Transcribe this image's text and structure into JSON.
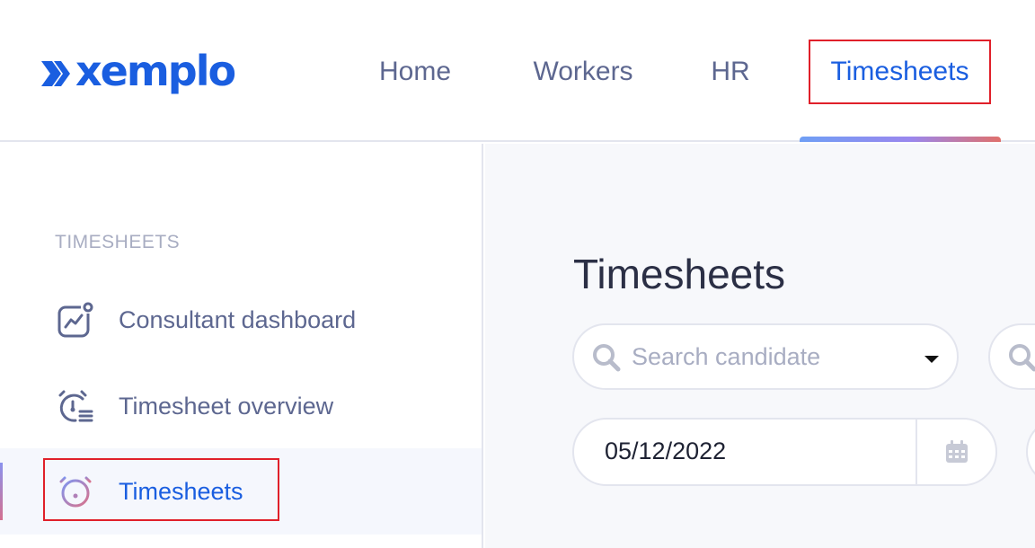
{
  "app": {
    "logo_text": "xemplo"
  },
  "nav": {
    "items": [
      {
        "label": "Home"
      },
      {
        "label": "Workers"
      },
      {
        "label": "HR"
      },
      {
        "label": "Timesheets",
        "active": true
      }
    ]
  },
  "sidebar": {
    "heading": "TIMESHEETS",
    "items": [
      {
        "label": "Consultant dashboard",
        "icon": "chart-dashboard-icon"
      },
      {
        "label": "Timesheet overview",
        "icon": "clock-list-icon"
      },
      {
        "label": "Timesheets",
        "icon": "alarm-clock-icon",
        "active": true
      }
    ]
  },
  "main": {
    "title": "Timesheets",
    "search": {
      "placeholder": "Search candidate"
    },
    "date": {
      "value": "05/12/2022"
    }
  },
  "colors": {
    "brand": "#1a5ee0",
    "nav_text": "#5d6790",
    "highlight_border": "#e0202a",
    "muted": "#a8adc2"
  }
}
